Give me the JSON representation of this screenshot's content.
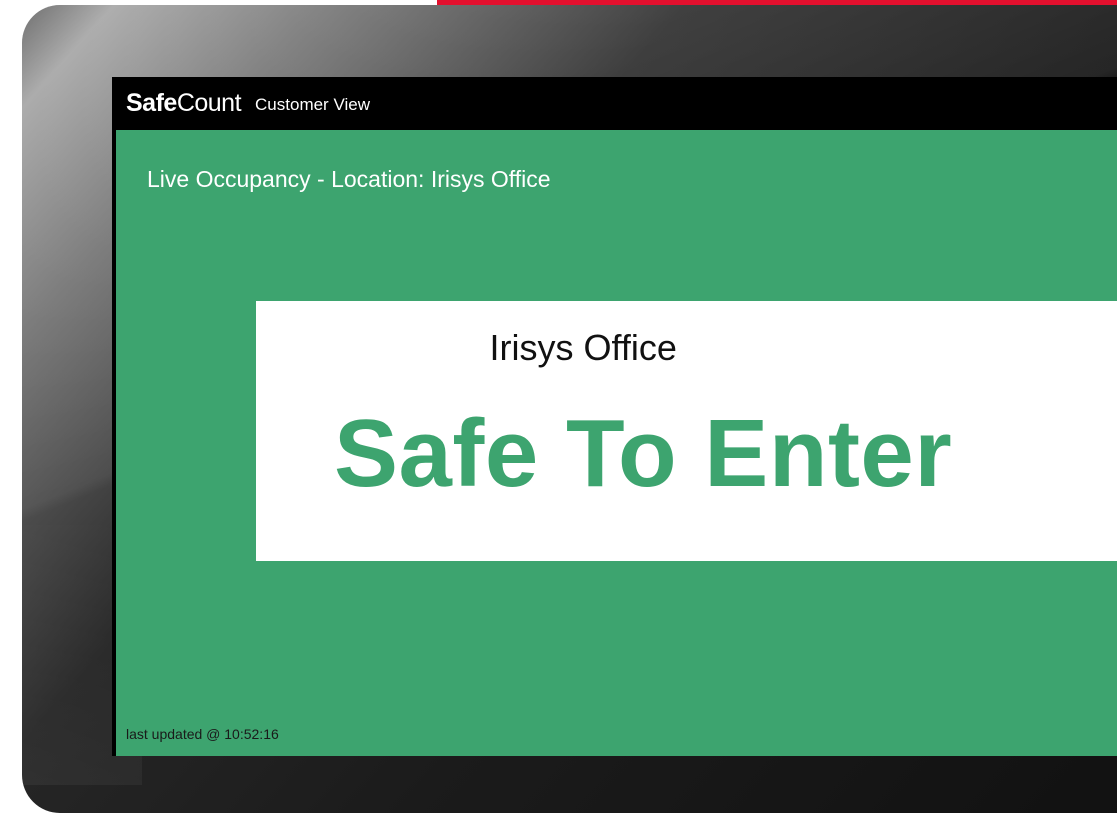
{
  "app": {
    "brand_bold": "Safe",
    "brand_light": "Count",
    "view_label": "Customer View"
  },
  "main": {
    "heading": "Live Occupancy - Location: Irisys Office",
    "card": {
      "location_name": "Irisys Office",
      "status_text": "Safe To Enter"
    },
    "last_updated": "last updated @ 10:52:16"
  },
  "colors": {
    "status_green": "#3da46f",
    "accent_red": "#e3102e",
    "topbar": "#000000"
  }
}
